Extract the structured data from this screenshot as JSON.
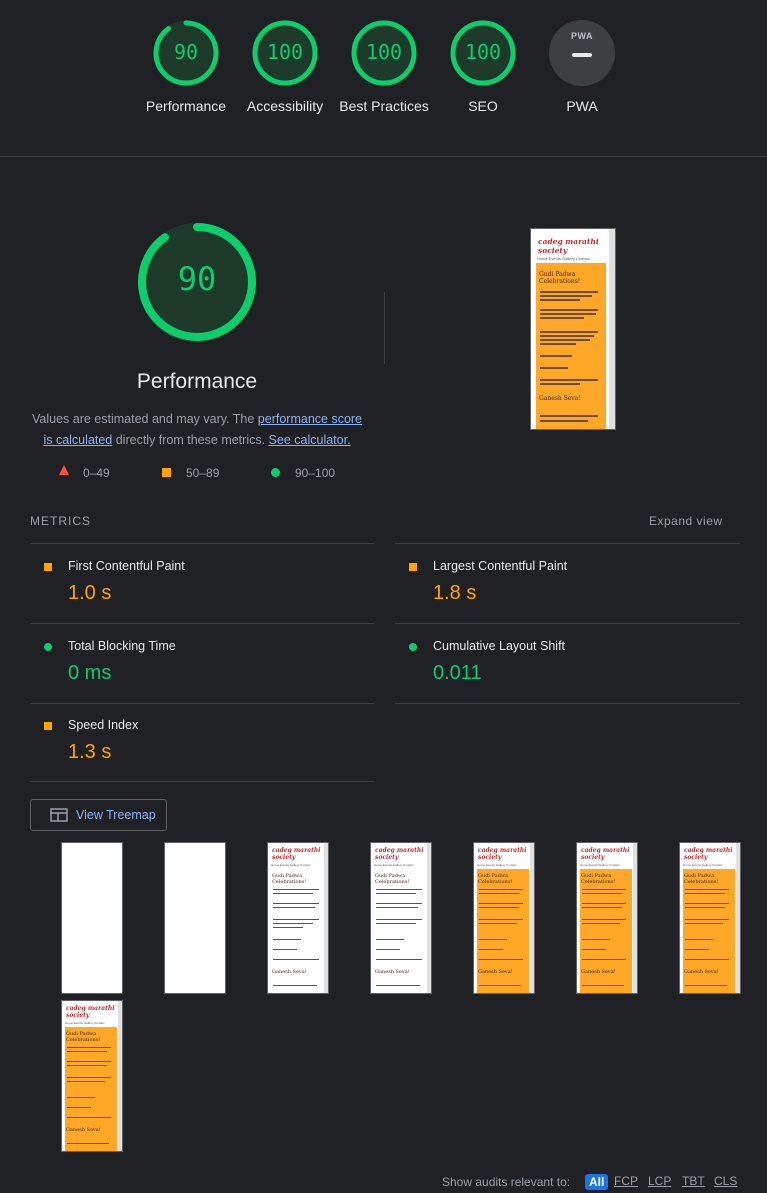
{
  "categories": [
    {
      "score": "90",
      "label": "Performance",
      "fraction": 0.9
    },
    {
      "score": "100",
      "label": "Accessibility",
      "fraction": 1.0
    },
    {
      "score": "100",
      "label": "Best Practices",
      "fraction": 1.0
    },
    {
      "score": "100",
      "label": "SEO",
      "fraction": 1.0
    },
    {
      "score": "",
      "label": "PWA",
      "badge": "PWA"
    }
  ],
  "performance": {
    "score": "90",
    "fraction": 0.9,
    "title": "Performance",
    "desc_pre": "Values are estimated and may vary. The ",
    "desc_link1": "performance score is calculated",
    "desc_mid": " directly from these metrics. ",
    "desc_link2": "See calculator."
  },
  "legend": {
    "fail": "0–49",
    "average": "50–89",
    "pass": "90–100"
  },
  "screenshot": {
    "logo_line1": "cadeg marathi",
    "logo_line2": "society",
    "nav": "Home  Events  Gallery  Contact",
    "heading1": "Gudi Padwa Celebrations!",
    "heading2": "Ganesh Seva!"
  },
  "metrics": {
    "header": "METRICS",
    "expand": "Expand view",
    "items": [
      {
        "label": "First Contentful Paint",
        "value": "1.0 s",
        "status": "average"
      },
      {
        "label": "Largest Contentful Paint",
        "value": "1.8 s",
        "status": "average"
      },
      {
        "label": "Total Blocking Time",
        "value": "0 ms",
        "status": "pass"
      },
      {
        "label": "Cumulative Layout Shift",
        "value": "0.011",
        "status": "pass"
      },
      {
        "label": "Speed Index",
        "value": "1.3 s",
        "status": "average"
      }
    ]
  },
  "treemap": {
    "label": "View Treemap"
  },
  "audits": {
    "label": "Show audits relevant to:",
    "filters": [
      "All",
      "FCP",
      "LCP",
      "TBT",
      "CLS"
    ]
  },
  "colors": {
    "pass": "#0cce6b",
    "average": "#ffa400",
    "fail": "#ff4e42",
    "link": "#8ab4f8",
    "background": "#202124"
  }
}
